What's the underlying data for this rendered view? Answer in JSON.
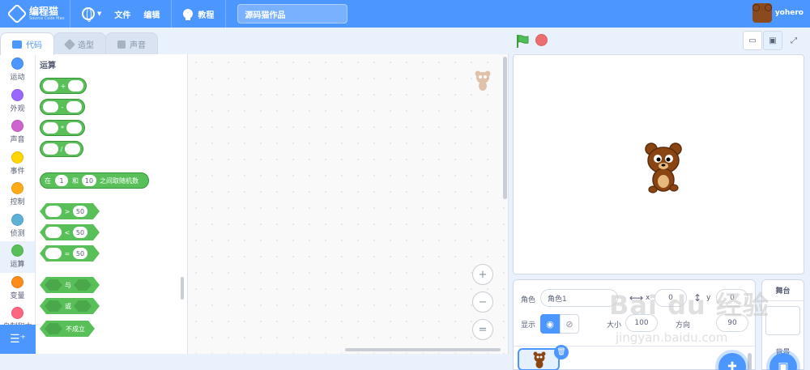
{
  "menubar": {
    "logo_text": "编程猫",
    "logo_sub": "Source Code Mao",
    "file_label": "文件",
    "edit_label": "编辑",
    "tutorial_label": "教程",
    "project_title": "源码猫作品",
    "username": "yohero"
  },
  "tabs": {
    "code": "代码",
    "costumes": "造型",
    "sounds": "声音"
  },
  "categories": [
    {
      "label": "运动",
      "color": "#4c97ff"
    },
    {
      "label": "外观",
      "color": "#9966ff"
    },
    {
      "label": "声音",
      "color": "#cf63cf"
    },
    {
      "label": "事件",
      "color": "#ffd500"
    },
    {
      "label": "控制",
      "color": "#ffab19"
    },
    {
      "label": "侦测",
      "color": "#5cb1d6"
    },
    {
      "label": "运算",
      "color": "#59c059"
    },
    {
      "label": "变量",
      "color": "#ff8c1a"
    },
    {
      "label": "自制积木",
      "color": "#ff6680"
    }
  ],
  "palette": {
    "title": "运算",
    "add": "+",
    "sub": "-",
    "mul": "*",
    "div": "/",
    "random_prefix": "在",
    "random_from": "1",
    "random_and": "和",
    "random_to": "10",
    "random_suffix": "之间取随机数",
    "gt": ">",
    "lt": "<",
    "eq": "=",
    "cmp_value": "50",
    "and": "与",
    "or": "或",
    "not": "不成立"
  },
  "zoom": {
    "in": "+",
    "out": "−",
    "reset": "="
  },
  "sprite_info": {
    "sprite_label": "角色",
    "sprite_name": "角色1",
    "x_label": "x",
    "x_value": "0",
    "y_label": "y",
    "y_value": "0",
    "show_label": "显示",
    "size_label": "大小",
    "size_value": "100",
    "direction_label": "方向",
    "direction_value": "90"
  },
  "stage_panel": {
    "header": "舞台",
    "backdrops_label": "背景"
  },
  "watermark": {
    "text": "Bai du 经验",
    "url": "jingyan.baidu.com"
  },
  "colors": {
    "accent": "#4c97ff",
    "operators": "#59c059",
    "stop": "#ec5959",
    "flag": "#4cbf56"
  }
}
